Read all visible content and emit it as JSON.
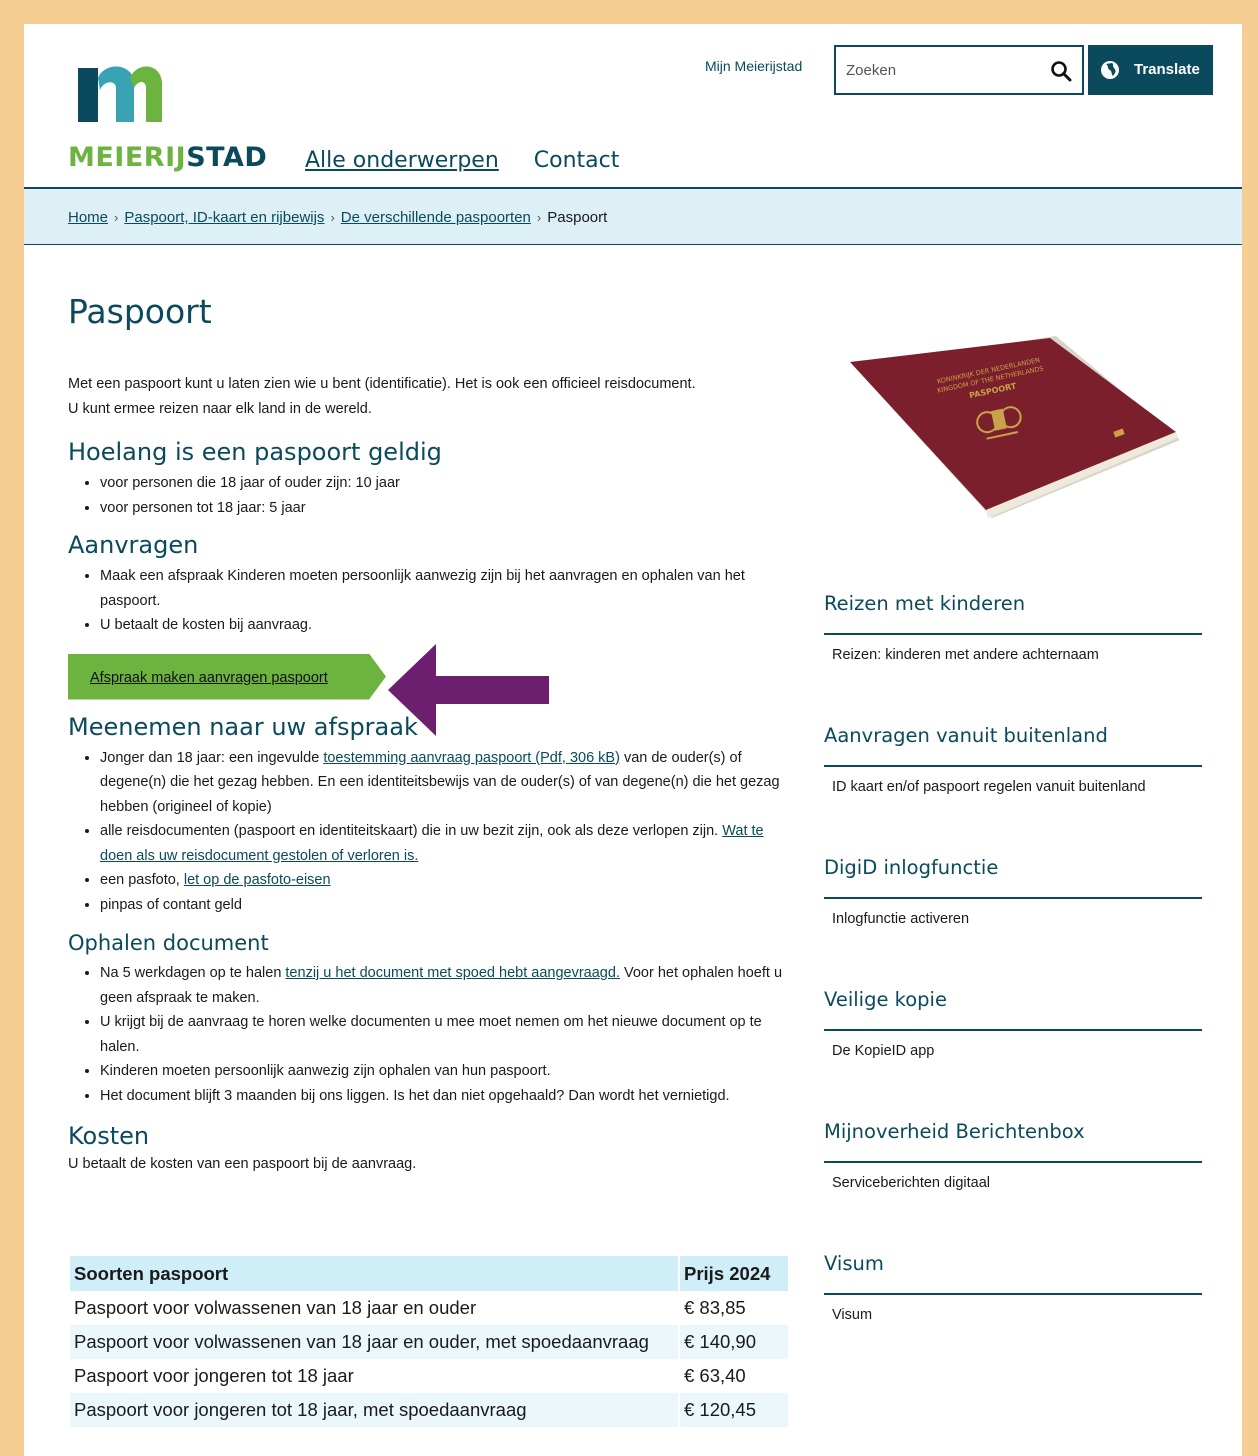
{
  "header": {
    "logo_text_green": "MEIERIJ",
    "logo_text_blue": "STAD",
    "mijn_link": "Mijn Meierijstad",
    "search_placeholder": "Zoeken",
    "translate_label": "Translate",
    "nav": [
      "Alle onderwerpen",
      "Contact"
    ]
  },
  "breadcrumb": [
    "Home",
    "Paspoort, ID-kaart en rijbewijs",
    "De verschillende paspoorten",
    "Paspoort"
  ],
  "main": {
    "title": "Paspoort",
    "intro_1": "Met een paspoort kunt u laten zien wie u bent (identificatie). Het is ook een officieel reisdocument.",
    "intro_2": "U kunt ermee reizen naar elk land in de wereld.",
    "h_geldig": "Hoelang is een paspoort geldig",
    "geldig_items": [
      "voor personen die 18 jaar of ouder zijn: 10 jaar",
      "voor personen tot 18 jaar: 5 jaar"
    ],
    "h_aanvragen": "Aanvragen",
    "aanvragen_items": [
      "Maak een afspraak  Kinderen moeten persoonlijk aanwezig zijn bij het aanvragen en ophalen van het paspoort.",
      "U betaalt de kosten bij aanvraag."
    ],
    "cta_label": "Afspraak maken aanvragen paspoort",
    "h_meenemen": "Meenemen naar uw afspraak",
    "meenemen": {
      "i1_pre": "Jonger dan 18 jaar: een ingevulde ",
      "i1_link": "toestemming aanvraag paspoort (Pdf, 306 kB)",
      "i1_post": " van de ouder(s) of degene(n) die het gezag hebben.  En een identiteitsbewijs van de ouder(s) of van degene(n) die het gezag hebben (origineel of kopie)",
      "i2_pre": "alle reisdocumenten (paspoort en identiteitskaart) die in uw bezit zijn, ook als deze verlopen zijn. ",
      "i2_link": "Wat te doen als uw reisdocument gestolen of verloren is.",
      "i3_pre": "een pasfoto, ",
      "i3_link": "let op de pasfoto-eisen",
      "i4": "pinpas of contant geld"
    },
    "h_ophalen": "Ophalen document",
    "ophalen": {
      "i1_pre": "Na 5 werkdagen op te halen ",
      "i1_link": "tenzij u het document met spoed hebt aangevraagd.",
      "i1_post": " Voor het ophalen hoeft u geen afspraak te maken.",
      "i2": "U krijgt bij de aanvraag te horen welke documenten u mee moet nemen om het nieuwe document op te halen.",
      "i3": "Kinderen moeten persoonlijk aanwezig zijn ophalen van hun paspoort.",
      "i4": "Het document blijft 3 maanden bij ons liggen. Is het dan niet opgehaald? Dan wordt het vernietigd."
    },
    "h_kosten": "Kosten",
    "kosten_text": "U betaalt de kosten van een paspoort bij de aanvraag.",
    "table": {
      "headers": [
        "Soorten paspoort",
        "Prijs 2024"
      ],
      "rows": [
        [
          "Paspoort voor volwassenen van 18 jaar en ouder",
          "€ 83,85"
        ],
        [
          "Paspoort voor volwassenen van 18 jaar en ouder, met spoedaanvraag",
          "€ 140,90"
        ],
        [
          "Paspoort voor jongeren tot 18 jaar",
          "€ 63,40"
        ],
        [
          "Paspoort voor jongeren tot 18 jaar, met spoedaanvraag",
          "€ 120,45"
        ]
      ]
    }
  },
  "passport_image": {
    "line1": "KONINKRIJK DER NEDERLANDEN",
    "line2": "KINGDOM OF THE NETHERLANDS",
    "line3": "PASPOORT",
    "cover_color": "#7a1f2b"
  },
  "sidebar": [
    {
      "title": "Reizen met kinderen",
      "link": "Reizen: kinderen met andere achternaam"
    },
    {
      "title": "Aanvragen vanuit buitenland",
      "link": "ID kaart en/of paspoort regelen vanuit buitenland"
    },
    {
      "title": "DigiD inlogfunctie",
      "link": "Inlogfunctie activeren"
    },
    {
      "title": "Veilige kopie",
      "link": "De KopieID app"
    },
    {
      "title": "Mijnoverheid Berichtenbox",
      "link": "Serviceberichten digitaal"
    },
    {
      "title": "Visum",
      "link": "Visum"
    }
  ],
  "colors": {
    "brand_dark": "#0a4a5c",
    "brand_green": "#6cb33f",
    "arrow": "#6b1f6e",
    "frame": "#f6cd93"
  }
}
